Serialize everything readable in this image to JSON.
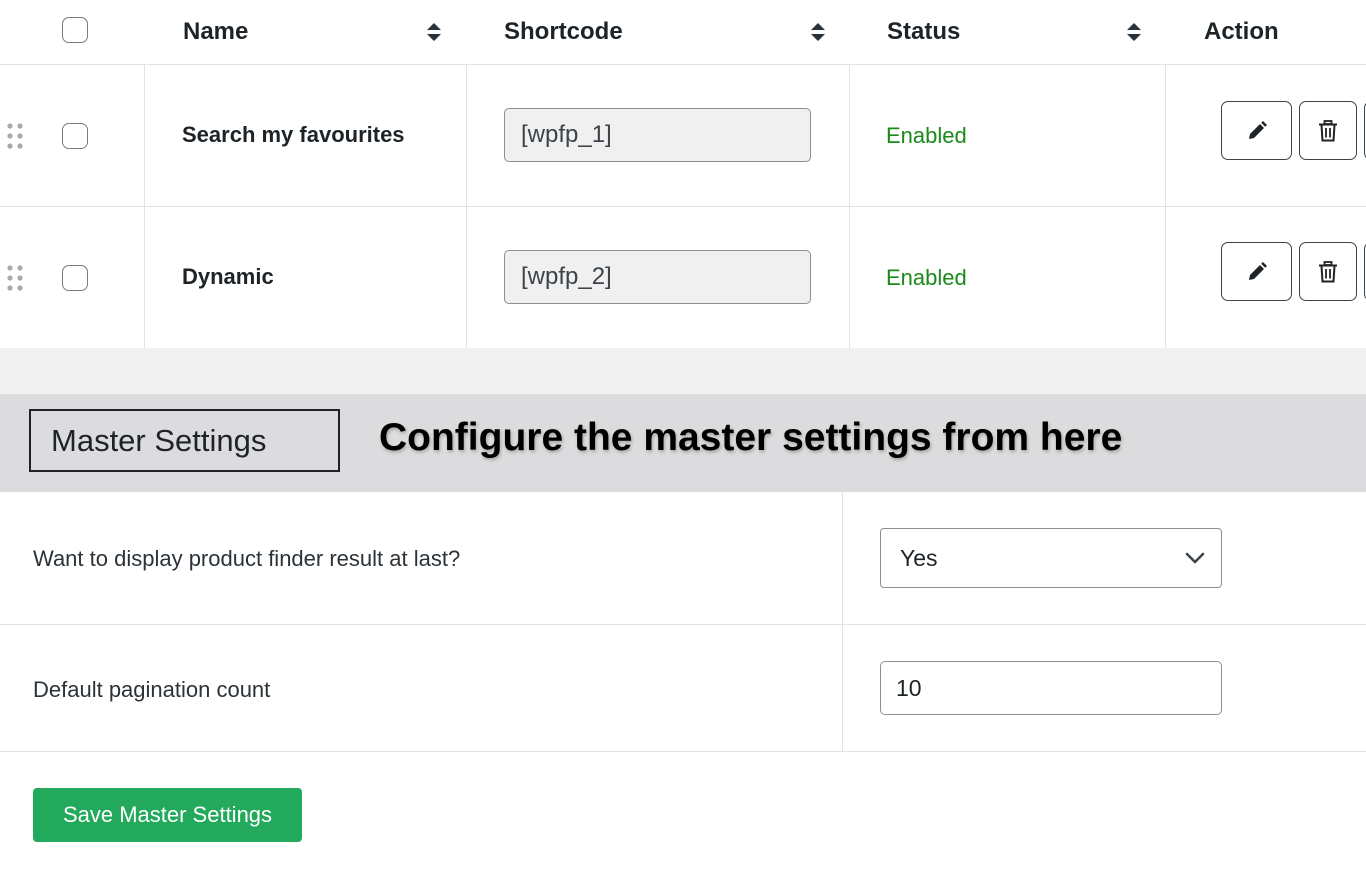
{
  "table": {
    "columns": {
      "name": "Name",
      "shortcode": "Shortcode",
      "status": "Status",
      "action": "Action"
    },
    "rows": [
      {
        "name": "Search my favourites",
        "shortcode": "[wpfp_1]",
        "status": "Enabled"
      },
      {
        "name": "Dynamic",
        "shortcode": "[wpfp_2]",
        "status": "Enabled"
      }
    ]
  },
  "master_settings": {
    "title": "Master Settings",
    "annotation": "Configure the master settings from here",
    "fields": {
      "display_last": {
        "label": "Want to display product finder result at last?",
        "value": "Yes"
      },
      "pagination": {
        "label": "Default pagination count",
        "value": "10"
      }
    },
    "save_label": "Save Master Settings"
  },
  "colors": {
    "status_enabled": "#1a8a1a",
    "save_button": "#22a95b",
    "banner_bg": "#dcdcde"
  },
  "icons": {
    "sort": "sort-icon",
    "drag": "drag-handle-icon",
    "edit": "pencil-icon",
    "delete": "trash-icon",
    "dropdown": "chevron-down-icon"
  }
}
